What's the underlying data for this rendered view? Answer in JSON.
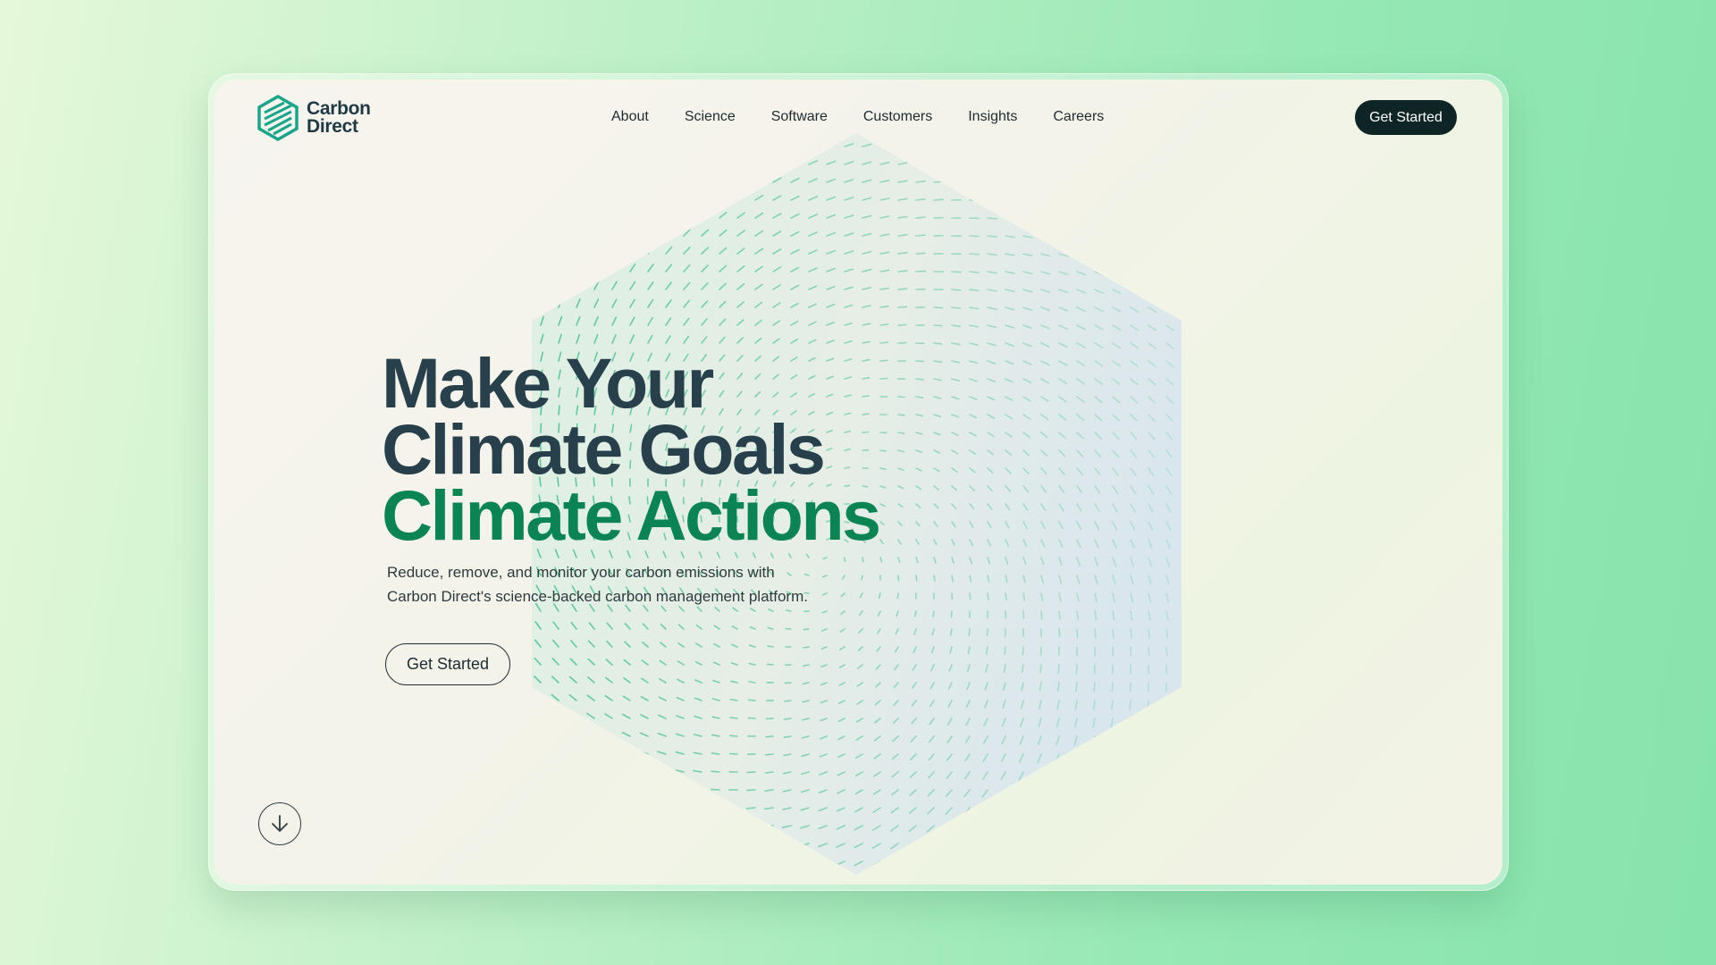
{
  "brand": {
    "line1": "Carbon",
    "line2": "Direct"
  },
  "nav": {
    "items": [
      {
        "label": "About"
      },
      {
        "label": "Science"
      },
      {
        "label": "Software"
      },
      {
        "label": "Customers"
      },
      {
        "label": "Insights"
      },
      {
        "label": "Careers"
      }
    ],
    "cta_label": "Get Started"
  },
  "hero": {
    "title_line1": "Make Your",
    "title_line2": "Climate Goals",
    "title_line3": "Climate Actions",
    "subtitle_line1": "Reduce, remove, and monitor your carbon emissions with",
    "subtitle_line2": "Carbon Direct's science-backed carbon management platform.",
    "cta_label": "Get Started"
  },
  "icons": {
    "logo": "hexagon-logo-icon",
    "scroll": "arrow-down-icon",
    "hero_graphic": "hexagon-pattern"
  },
  "colors": {
    "accent_green": "#0b8454",
    "heading_dark": "#27404b",
    "button_dark": "#0f2525",
    "pattern_green": "#5cc79a"
  }
}
